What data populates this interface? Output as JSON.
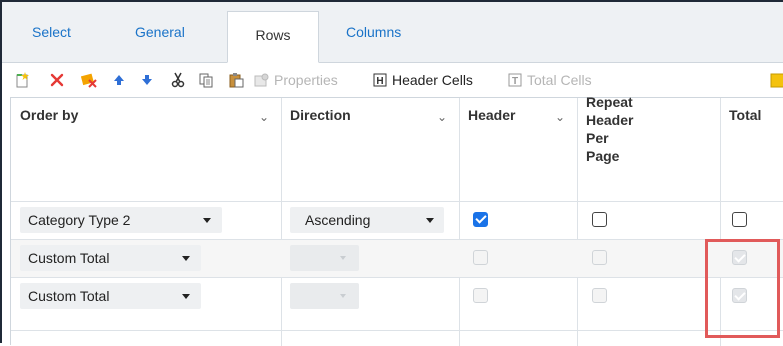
{
  "tabs": [
    {
      "label": "Select",
      "active": false
    },
    {
      "label": "General",
      "active": false
    },
    {
      "label": "Rows",
      "active": true
    },
    {
      "label": "Columns",
      "active": false
    }
  ],
  "toolbar": {
    "new_icon": "new-row-icon",
    "delete_icon": "delete-icon",
    "clear_icon": "clear-icon",
    "move_up_icon": "arrow-up-icon",
    "move_down_icon": "arrow-down-icon",
    "cut_icon": "cut-icon",
    "copy_icon": "copy-icon",
    "paste_icon": "paste-icon",
    "properties_label": "Properties",
    "header_cells_label": "Header Cells",
    "total_cells_label": "Total Cells",
    "colors": {
      "delete": "#e53935",
      "arrows": "#2f6fd6",
      "new": "#4caf50",
      "clear": "#f4a300"
    }
  },
  "columns": {
    "order_by": "Order by",
    "direction": "Direction",
    "header": "Header",
    "repeat_header_per_page": [
      "Repeat",
      "Header",
      "Per",
      "Page"
    ],
    "total": "Total"
  },
  "rows": [
    {
      "order_by": "Category Type 2",
      "direction": "Ascending",
      "direction_enabled": true,
      "header_checked": true,
      "header_enabled": true,
      "repeat_checked": false,
      "repeat_enabled": true,
      "total_checked": false,
      "total_enabled": true
    },
    {
      "order_by": "Custom Total",
      "direction": "",
      "direction_enabled": false,
      "header_checked": false,
      "header_enabled": false,
      "repeat_checked": false,
      "repeat_enabled": false,
      "total_checked": true,
      "total_enabled": false
    },
    {
      "order_by": "Custom Total",
      "direction": "",
      "direction_enabled": false,
      "header_checked": false,
      "header_enabled": false,
      "repeat_checked": false,
      "repeat_enabled": false,
      "total_checked": true,
      "total_enabled": false
    }
  ],
  "highlight_color": "#e15a5a"
}
